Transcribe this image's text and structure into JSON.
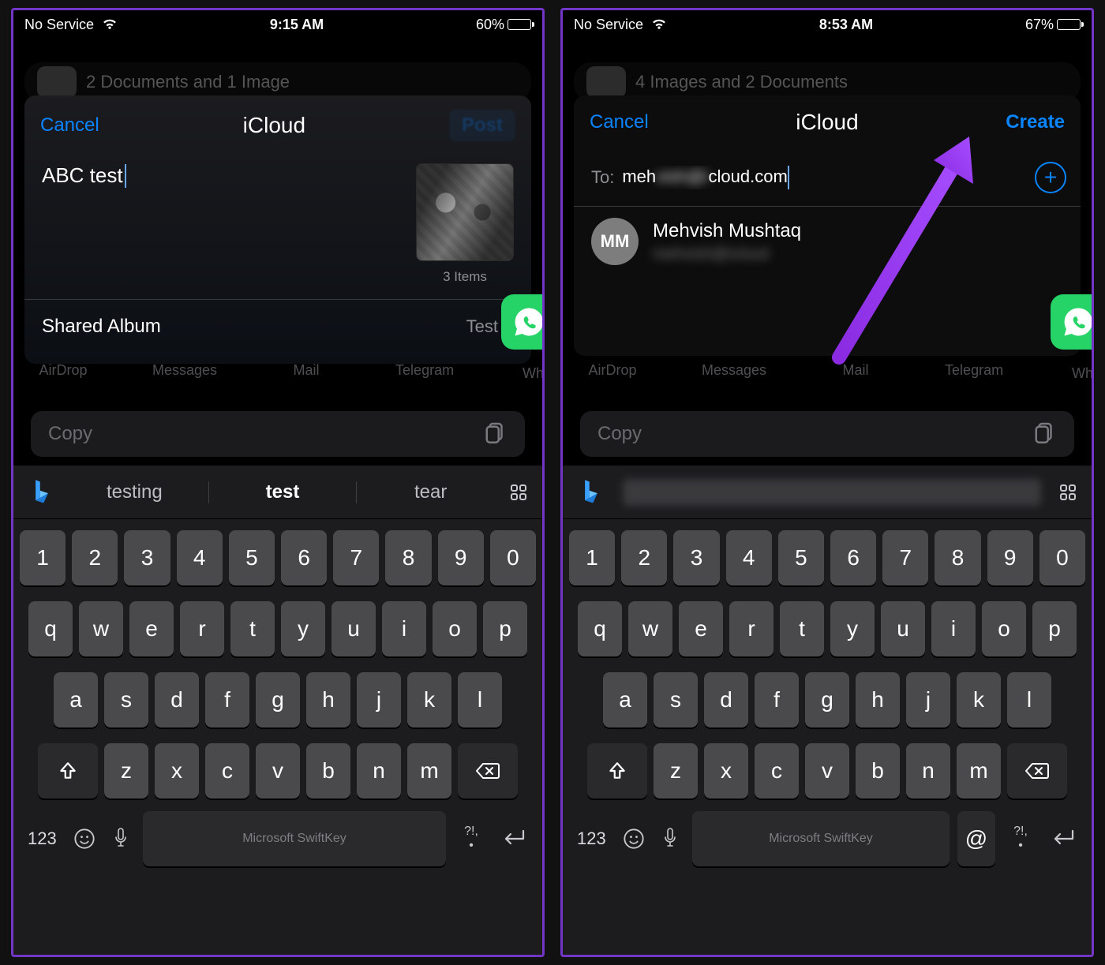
{
  "left": {
    "status": {
      "carrier": "No Service",
      "time": "9:15 AM",
      "battery_pct": "60%",
      "battery_fill": 60
    },
    "bgcard": "2 Documents and 1 Image",
    "dialog": {
      "cancel": "Cancel",
      "title": "iCloud",
      "input": "ABC test",
      "items_caption": "3 Items",
      "row_label": "Shared Album",
      "row_value": "Test"
    },
    "share_labels": [
      "AirDrop",
      "Messages",
      "Mail",
      "Telegram"
    ],
    "wa_label": "Wh",
    "copy": "Copy",
    "suggestions": [
      "testing",
      "test",
      "tear"
    ],
    "kb_brand": "Microsoft SwiftKey",
    "kb_abc": "123",
    "kb_at": ""
  },
  "right": {
    "status": {
      "carrier": "No Service",
      "time": "8:53 AM",
      "battery_pct": "67%",
      "battery_fill": 67
    },
    "bgcard": "4 Images and 2 Documents",
    "dialog": {
      "cancel": "Cancel",
      "title": "iCloud",
      "create": "Create",
      "to_label": "To:",
      "to_value_prefix": "meh",
      "to_value_mid": "vish@i",
      "to_value_suffix": "cloud.com",
      "contact_initials": "MM",
      "contact_name": "Mehvish Mushtaq",
      "contact_sub": "mehvish@icloud"
    },
    "share_labels": [
      "AirDrop",
      "Messages",
      "Mail",
      "Telegram"
    ],
    "wa_label": "Wh",
    "copy": "Copy",
    "kb_brand": "Microsoft SwiftKey",
    "kb_abc": "123",
    "kb_at": "@"
  },
  "keys": {
    "row1": [
      "1",
      "2",
      "3",
      "4",
      "5",
      "6",
      "7",
      "8",
      "9",
      "0"
    ],
    "row2": [
      "q",
      "w",
      "e",
      "r",
      "t",
      "y",
      "u",
      "i",
      "o",
      "p"
    ],
    "row3": [
      "a",
      "s",
      "d",
      "f",
      "g",
      "h",
      "j",
      "k",
      "l"
    ],
    "row4": [
      "z",
      "x",
      "c",
      "v",
      "b",
      "n",
      "m"
    ]
  }
}
